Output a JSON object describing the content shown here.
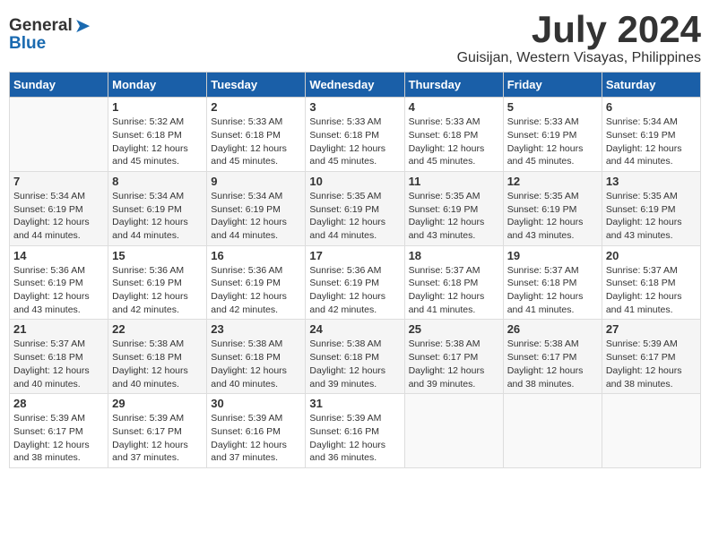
{
  "header": {
    "logo": {
      "general": "General",
      "blue": "Blue"
    },
    "title": "July 2024",
    "location": "Guisijan, Western Visayas, Philippines"
  },
  "weekdays": [
    "Sunday",
    "Monday",
    "Tuesday",
    "Wednesday",
    "Thursday",
    "Friday",
    "Saturday"
  ],
  "weeks": [
    [
      {
        "day": "",
        "empty": true
      },
      {
        "day": "1",
        "sunrise": "5:32 AM",
        "sunset": "6:18 PM",
        "daylight": "12 hours and 45 minutes."
      },
      {
        "day": "2",
        "sunrise": "5:33 AM",
        "sunset": "6:18 PM",
        "daylight": "12 hours and 45 minutes."
      },
      {
        "day": "3",
        "sunrise": "5:33 AM",
        "sunset": "6:18 PM",
        "daylight": "12 hours and 45 minutes."
      },
      {
        "day": "4",
        "sunrise": "5:33 AM",
        "sunset": "6:18 PM",
        "daylight": "12 hours and 45 minutes."
      },
      {
        "day": "5",
        "sunrise": "5:33 AM",
        "sunset": "6:19 PM",
        "daylight": "12 hours and 45 minutes."
      },
      {
        "day": "6",
        "sunrise": "5:34 AM",
        "sunset": "6:19 PM",
        "daylight": "12 hours and 44 minutes."
      }
    ],
    [
      {
        "day": "7",
        "sunrise": "5:34 AM",
        "sunset": "6:19 PM",
        "daylight": "12 hours and 44 minutes."
      },
      {
        "day": "8",
        "sunrise": "5:34 AM",
        "sunset": "6:19 PM",
        "daylight": "12 hours and 44 minutes."
      },
      {
        "day": "9",
        "sunrise": "5:34 AM",
        "sunset": "6:19 PM",
        "daylight": "12 hours and 44 minutes."
      },
      {
        "day": "10",
        "sunrise": "5:35 AM",
        "sunset": "6:19 PM",
        "daylight": "12 hours and 44 minutes."
      },
      {
        "day": "11",
        "sunrise": "5:35 AM",
        "sunset": "6:19 PM",
        "daylight": "12 hours and 43 minutes."
      },
      {
        "day": "12",
        "sunrise": "5:35 AM",
        "sunset": "6:19 PM",
        "daylight": "12 hours and 43 minutes."
      },
      {
        "day": "13",
        "sunrise": "5:35 AM",
        "sunset": "6:19 PM",
        "daylight": "12 hours and 43 minutes."
      }
    ],
    [
      {
        "day": "14",
        "sunrise": "5:36 AM",
        "sunset": "6:19 PM",
        "daylight": "12 hours and 43 minutes."
      },
      {
        "day": "15",
        "sunrise": "5:36 AM",
        "sunset": "6:19 PM",
        "daylight": "12 hours and 42 minutes."
      },
      {
        "day": "16",
        "sunrise": "5:36 AM",
        "sunset": "6:19 PM",
        "daylight": "12 hours and 42 minutes."
      },
      {
        "day": "17",
        "sunrise": "5:36 AM",
        "sunset": "6:19 PM",
        "daylight": "12 hours and 42 minutes."
      },
      {
        "day": "18",
        "sunrise": "5:37 AM",
        "sunset": "6:18 PM",
        "daylight": "12 hours and 41 minutes."
      },
      {
        "day": "19",
        "sunrise": "5:37 AM",
        "sunset": "6:18 PM",
        "daylight": "12 hours and 41 minutes."
      },
      {
        "day": "20",
        "sunrise": "5:37 AM",
        "sunset": "6:18 PM",
        "daylight": "12 hours and 41 minutes."
      }
    ],
    [
      {
        "day": "21",
        "sunrise": "5:37 AM",
        "sunset": "6:18 PM",
        "daylight": "12 hours and 40 minutes."
      },
      {
        "day": "22",
        "sunrise": "5:38 AM",
        "sunset": "6:18 PM",
        "daylight": "12 hours and 40 minutes."
      },
      {
        "day": "23",
        "sunrise": "5:38 AM",
        "sunset": "6:18 PM",
        "daylight": "12 hours and 40 minutes."
      },
      {
        "day": "24",
        "sunrise": "5:38 AM",
        "sunset": "6:18 PM",
        "daylight": "12 hours and 39 minutes."
      },
      {
        "day": "25",
        "sunrise": "5:38 AM",
        "sunset": "6:17 PM",
        "daylight": "12 hours and 39 minutes."
      },
      {
        "day": "26",
        "sunrise": "5:38 AM",
        "sunset": "6:17 PM",
        "daylight": "12 hours and 38 minutes."
      },
      {
        "day": "27",
        "sunrise": "5:39 AM",
        "sunset": "6:17 PM",
        "daylight": "12 hours and 38 minutes."
      }
    ],
    [
      {
        "day": "28",
        "sunrise": "5:39 AM",
        "sunset": "6:17 PM",
        "daylight": "12 hours and 38 minutes."
      },
      {
        "day": "29",
        "sunrise": "5:39 AM",
        "sunset": "6:17 PM",
        "daylight": "12 hours and 37 minutes."
      },
      {
        "day": "30",
        "sunrise": "5:39 AM",
        "sunset": "6:16 PM",
        "daylight": "12 hours and 37 minutes."
      },
      {
        "day": "31",
        "sunrise": "5:39 AM",
        "sunset": "6:16 PM",
        "daylight": "12 hours and 36 minutes."
      },
      {
        "day": "",
        "empty": true
      },
      {
        "day": "",
        "empty": true
      },
      {
        "day": "",
        "empty": true
      }
    ]
  ]
}
